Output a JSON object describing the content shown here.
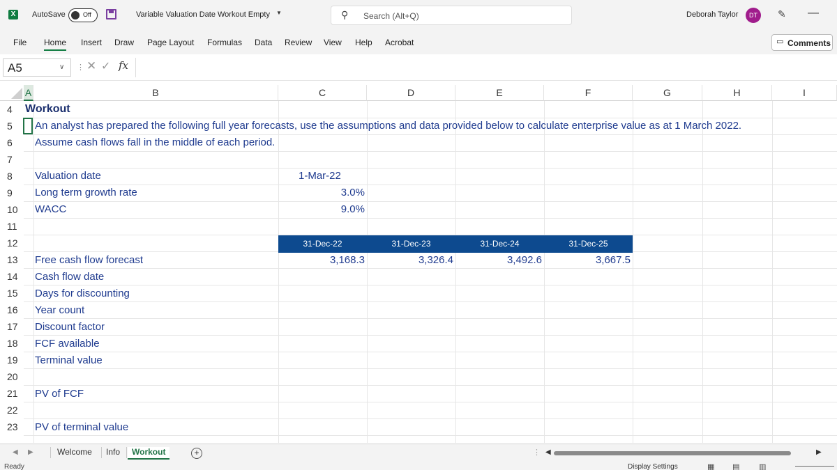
{
  "titlebar": {
    "app_logo": "X",
    "autosave_label": "AutoSave",
    "autosave_state": "Off",
    "document_title": "Variable Valuation Date Workout Empty",
    "search_placeholder": "Search (Alt+Q)",
    "user_name": "Deborah Taylor",
    "user_initials": "DT"
  },
  "ribbon": {
    "tabs": [
      "File",
      "Home",
      "Insert",
      "Draw",
      "Page Layout",
      "Formulas",
      "Data",
      "Review",
      "View",
      "Help",
      "Acrobat"
    ],
    "active_tab": "Home",
    "comments_label": "Comments"
  },
  "formula_bar": {
    "name_box": "A5",
    "fx_label": "fx",
    "content": ""
  },
  "grid": {
    "columns": [
      "A",
      "B",
      "C",
      "D",
      "E",
      "F",
      "G",
      "H",
      "I"
    ],
    "selected_column": "A",
    "rows": [
      "4",
      "5",
      "6",
      "7",
      "8",
      "9",
      "10",
      "11",
      "12",
      "13",
      "14",
      "15",
      "16",
      "17",
      "18",
      "19",
      "20",
      "21",
      "22",
      "23"
    ],
    "cells": {
      "title": "Workout",
      "instruction_1": "An analyst has prepared the following full year forecasts, use the assumptions and data provided below to calculate enterprise value as at 1 March 2022.",
      "instruction_2": "Assume cash flows fall in the middle of each period.",
      "valuation_date_label": "Valuation date",
      "valuation_date_value": "1-Mar-22",
      "growth_label": "Long term growth rate",
      "growth_value": "3.0%",
      "wacc_label": "WACC",
      "wacc_value": "9.0%",
      "period_headers": [
        "31-Dec-22",
        "31-Dec-23",
        "31-Dec-24",
        "31-Dec-25"
      ],
      "fcf_label": "Free cash flow forecast",
      "fcf_values": [
        "3,168.3",
        "3,326.4",
        "3,492.6",
        "3,667.5"
      ],
      "labels_after": {
        "r14": "Cash flow date",
        "r15": "Days for discounting",
        "r16": "Year count",
        "r17": "Discount factor",
        "r18": "FCF available",
        "r19": "Terminal value",
        "r21": "PV of FCF",
        "r23": "PV of terminal value"
      }
    }
  },
  "sheet_tabs": {
    "tabs": [
      "Welcome",
      "Info",
      "Workout"
    ],
    "active": "Workout"
  },
  "status_bar": {
    "status": "Ready",
    "display_settings": "Display Settings"
  },
  "colors": {
    "excel_green": "#217346",
    "header_band": "#0d4a8f",
    "text_blue": "#1f3b8f",
    "avatar": "#a01c8c"
  }
}
